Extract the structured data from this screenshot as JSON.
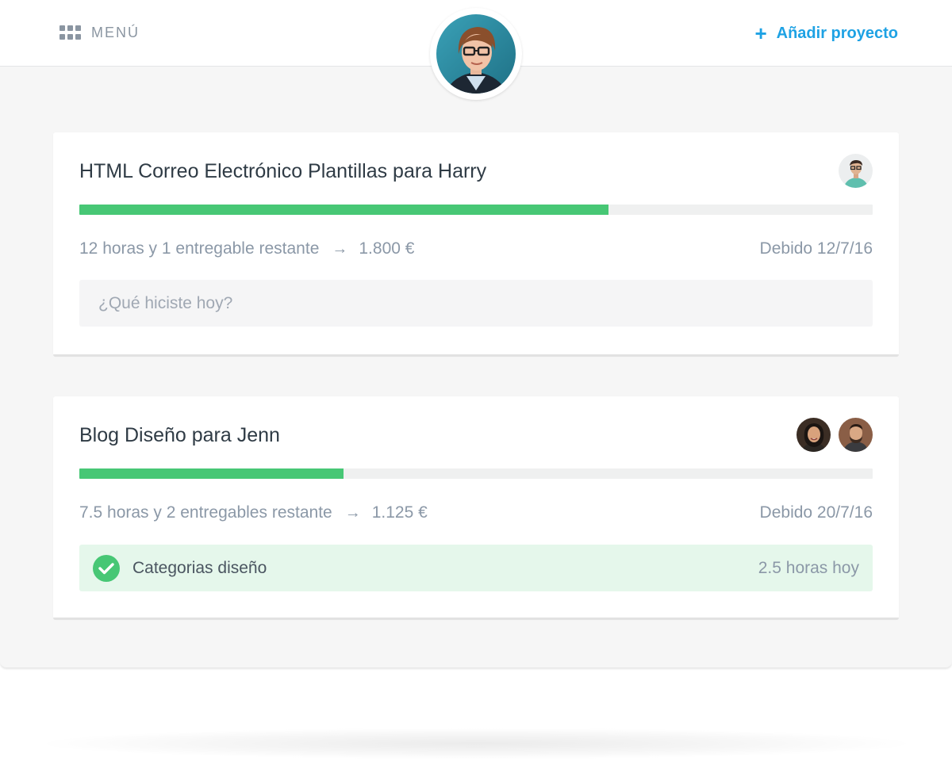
{
  "header": {
    "menu_label": "MENÚ",
    "menu_icon": "grid-icon",
    "add_project_label": "Añadir proyecto",
    "add_project_icon": "plus-icon",
    "accent_color": "#1ea2e4"
  },
  "projects": [
    {
      "title": "HTML Correo Electrónico Plantillas para Harry",
      "progress": 0.667,
      "summary": "12 horas y 1 entregable restante",
      "amount": "1.800 €",
      "due": "Debido 12/7/16",
      "input_placeholder": "¿Qué hiciste hoy?"
    },
    {
      "title": "Blog Diseño para Jenn",
      "progress": 0.333,
      "summary": "7.5 horas y 2 entregables restante",
      "amount": "1.125 €",
      "due": "Debido 20/7/16",
      "completed_task": {
        "label": "Categorias diseño",
        "hours": "2.5 horas hoy"
      }
    }
  ],
  "colors": {
    "progress": "#47c775",
    "track": "#eff0f0",
    "done_background": "#e5f7eb"
  }
}
